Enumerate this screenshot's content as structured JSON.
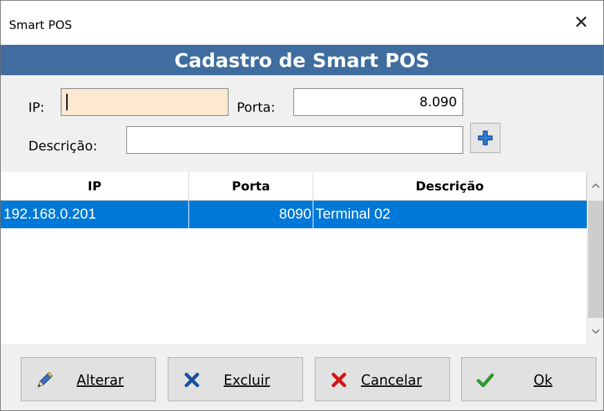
{
  "window": {
    "title": "Smart POS",
    "close_glyph": "✕"
  },
  "banner": {
    "title": "Cadastro de Smart POS"
  },
  "form": {
    "ip_label": "IP:",
    "ip_value": "",
    "porta_label": "Porta:",
    "porta_value": "8.090",
    "descricao_label": "Descrição:",
    "descricao_value": "",
    "add_icon": "plus-icon"
  },
  "grid": {
    "columns": [
      "IP",
      "Porta",
      "Descrição"
    ],
    "rows": [
      {
        "ip": "192.168.0.201",
        "porta": "8090",
        "descricao": "Terminal 02",
        "selected": true
      }
    ]
  },
  "buttons": {
    "alterar": "Alterar",
    "excluir": "Excluir",
    "cancelar": "Cancelar",
    "ok": "Ok"
  },
  "colors": {
    "banner_bg": "#3f6d9f",
    "selection": "#0078d7",
    "ip_field_bg": "#fde8d2"
  }
}
